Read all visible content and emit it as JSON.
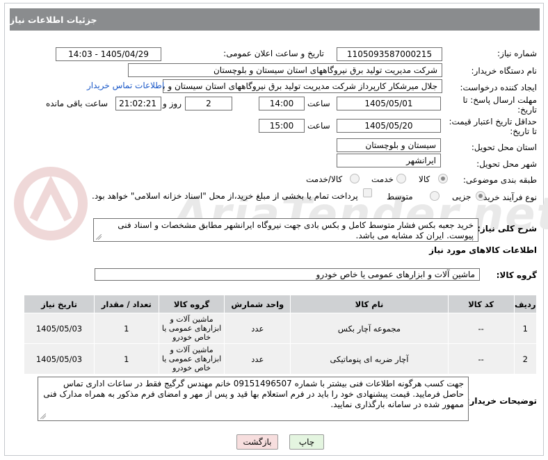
{
  "header": {
    "title": "جزئیات اطلاعات نیاز"
  },
  "watermark": "AriaTender.net",
  "form": {
    "need_number_label": "شماره نیاز:",
    "need_number": "1105093587000215",
    "announce_label": "تاریخ و ساعت اعلان عمومی:",
    "announce_value": "1405/04/29 - 14:03",
    "buyer_label": "نام دستگاه خریدار:",
    "buyer_value": "شرکت مدیریت تولید برق نیروگاههای استان سیستان و بلوچستان",
    "creator_label": "ایجاد کننده درخواست:",
    "creator_value": "جلال میرشکار کارپرداز شرکت مدیریت تولید برق نیروگاههای استان سیستان و بلوچستان",
    "contact_link": "اطلاعات تماس خریدار",
    "deadline_label_1": "مهلت ارسال پاسخ: تا",
    "deadline_label_2": "تاریخ:",
    "deadline_date": "1405/05/01",
    "time_label": "ساعت",
    "deadline_time": "14:00",
    "days_value": "2",
    "days_label": "روز و",
    "remaining_time": "21:02:21",
    "remaining_label": "ساعت باقی مانده",
    "validity_label_1": "حداقل تاریخ اعتبار قیمت:",
    "validity_label_2": "تا تاریخ:",
    "validity_date": "1405/05/20",
    "validity_time": "15:00",
    "province_label": "استان محل تحویل:",
    "province_value": "سیستان و بلوچستان",
    "city_label": "شهر محل تحویل:",
    "city_value": "ایرانشهر",
    "category_label": "طبقه بندی موضوعی:",
    "category_options": [
      "کالا",
      "خدمت",
      "کالا/خدمت"
    ],
    "category_selected": "کالا",
    "process_label": "نوع فرآیند خرید :",
    "process_options": [
      "جزیی",
      "متوسط"
    ],
    "process_selected": "جزیی",
    "payment_note": "پرداخت تمام یا بخشی از مبلغ خرید،از محل \"اسناد خزانه اسلامی\" خواهد بود.",
    "description_label": "شرح کلی نیاز:",
    "description_text": "خرید جعبه بکس فشار متوسط کامل و بکس بادی جهت نیروگاه ایرانشهر مطابق مشخصات و اسناد فنی پیوست. ایران کد مشابه می باشد."
  },
  "goods": {
    "section_title": "اطلاعات کالاهای مورد نیاز",
    "group_label": "گروه کالا:",
    "group_value": "ماشین آلات و ابزارهای عمومی یا خاص خودرو",
    "columns": [
      "ردیف",
      "کد کالا",
      "نام کالا",
      "واحد شمارش",
      "گروه کالا",
      "تعداد / مقدار",
      "تاریخ نیاز"
    ],
    "rows": [
      {
        "row": "1",
        "code": "--",
        "name": "مجموعه آچار بکس",
        "unit": "عدد",
        "group": "ماشین آلات و ابزارهای عمومی یا خاص خودرو",
        "qty": "1",
        "date": "1405/05/03"
      },
      {
        "row": "2",
        "code": "--",
        "name": "آچار ضربه ای پنوماتیکی",
        "unit": "عدد",
        "group": "ماشین آلات و ابزارهای عمومی یا خاص خودرو",
        "qty": "1",
        "date": "1405/05/03"
      }
    ]
  },
  "buyer_notes": {
    "label": "توضیحات خریدار:",
    "text": "جهت کسب هرگونه اطلاعات فنی بیشتر با شماره 09151496507 خانم مهندس گرگیج فقط در ساعات اداری تماس حاصل فرمایید. قیمت پیشنهادی خود را باید در فرم استعلام بها قید و پس از مهر و امضای فرم مذکور به همراه مدارک فنی ممهور شده در سامانه بارگذاری نمایید."
  },
  "buttons": {
    "print": "چاپ",
    "back": "بازگشت"
  },
  "colors": {
    "header_bg": "#8a8c8e",
    "table_header_bg": "#cfd1d3",
    "link": "#1a58c8",
    "back_button_bg": "#f7dede",
    "print_button_bg": "#e4f5e0"
  }
}
